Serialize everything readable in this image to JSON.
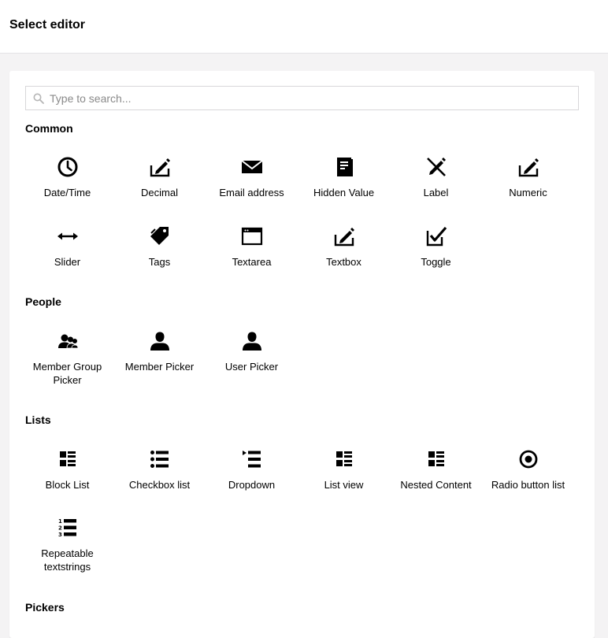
{
  "header": {
    "title": "Select editor"
  },
  "search": {
    "placeholder": "Type to search...",
    "value": ""
  },
  "groups": {
    "common": {
      "title": "Common",
      "items": [
        {
          "label": "Date/Time",
          "icon": "clock-icon"
        },
        {
          "label": "Decimal",
          "icon": "edit-icon"
        },
        {
          "label": "Email address",
          "icon": "envelope-icon"
        },
        {
          "label": "Hidden Value",
          "icon": "notebook-icon"
        },
        {
          "label": "Label",
          "icon": "pen-crossed-icon"
        },
        {
          "label": "Numeric",
          "icon": "edit-icon"
        },
        {
          "label": "Slider",
          "icon": "horizontal-arrows-icon"
        },
        {
          "label": "Tags",
          "icon": "tags-icon"
        },
        {
          "label": "Textarea",
          "icon": "window-icon"
        },
        {
          "label": "Textbox",
          "icon": "edit-icon"
        },
        {
          "label": "Toggle",
          "icon": "checkbox-checked-icon"
        }
      ]
    },
    "people": {
      "title": "People",
      "items": [
        {
          "label": "Member Group Picker",
          "icon": "users-icon"
        },
        {
          "label": "Member Picker",
          "icon": "user-icon"
        },
        {
          "label": "User Picker",
          "icon": "user-icon"
        }
      ]
    },
    "lists": {
      "title": "Lists",
      "items": [
        {
          "label": "Block List",
          "icon": "thumbnail-list-icon"
        },
        {
          "label": "Checkbox list",
          "icon": "bulleted-list-icon"
        },
        {
          "label": "Dropdown",
          "icon": "dropdown-list-icon"
        },
        {
          "label": "List view",
          "icon": "thumbnail-list-icon"
        },
        {
          "label": "Nested Content",
          "icon": "thumbnail-list-icon"
        },
        {
          "label": "Radio button list",
          "icon": "target-icon"
        },
        {
          "label": "Repeatable textstrings",
          "icon": "ordered-list-icon"
        }
      ]
    },
    "pickers": {
      "title": "Pickers"
    }
  }
}
